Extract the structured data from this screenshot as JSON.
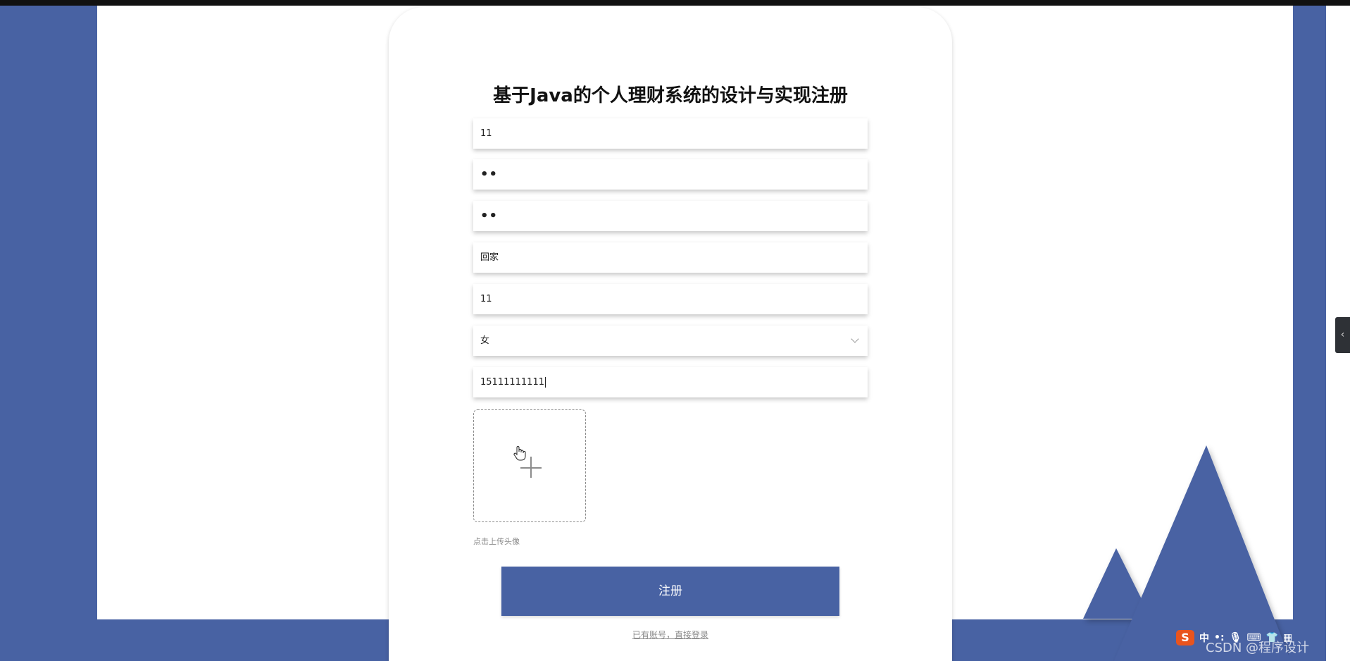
{
  "page": {
    "title": "基于Java的个人理财系统的设计与实现注册"
  },
  "form": {
    "username": "11",
    "password_mask": "••",
    "confirm_password_mask": "••",
    "name": "回家",
    "age": "11",
    "gender_selected": "女",
    "phone": "15111111111",
    "upload_hint": "点击上传头像",
    "submit_label": "注册",
    "login_link": "已有账号，直接登录"
  },
  "ime": {
    "logo": "S",
    "mode": "中"
  },
  "watermark": "CSDN @程序设计",
  "colors": {
    "accent": "#4862a3",
    "background": "#ffffff"
  }
}
